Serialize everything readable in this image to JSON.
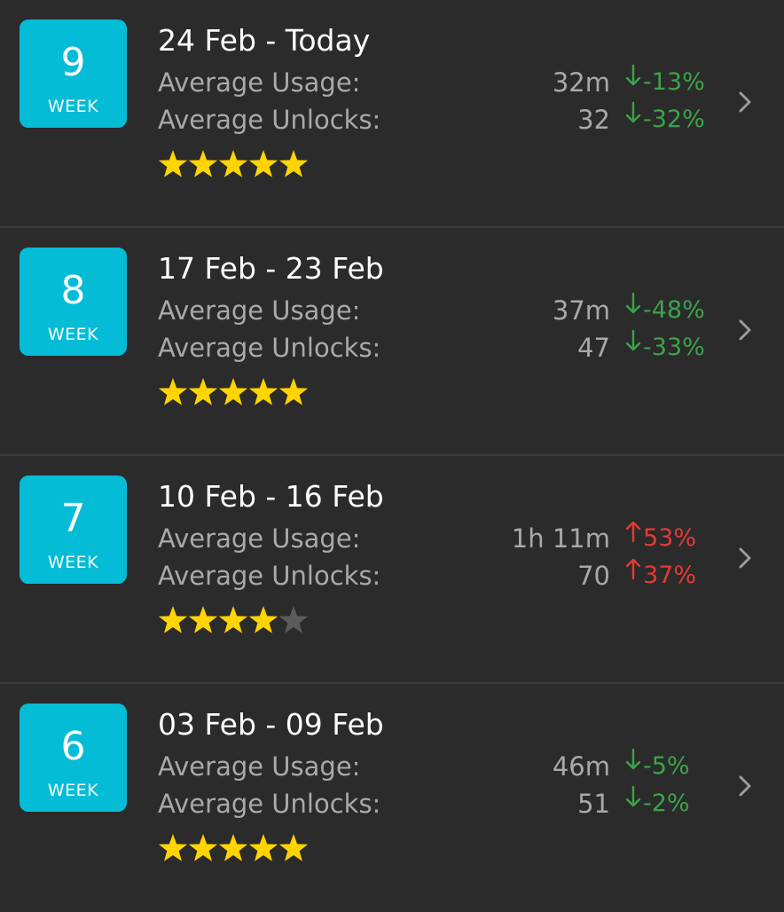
{
  "colors": {
    "background": "#2b2b2b",
    "badge": "#05bcd6",
    "star_on": "#ffd400",
    "star_off": "#5b5b5b",
    "down": "#3aa449",
    "up": "#e53a35",
    "muted_text": "#a9a9a9"
  },
  "weeks": [
    {
      "number": "9",
      "week_label": "WEEK",
      "range": "24 Feb - Today",
      "usage_label": "Average Usage:",
      "unlocks_label": "Average Unlocks:",
      "usage_value": "32m",
      "usage_direction": "down",
      "usage_change": "-13%",
      "unlocks_value": "32",
      "unlocks_direction": "down",
      "unlocks_change": "-32%",
      "rating": 5,
      "rating_max": 5
    },
    {
      "number": "8",
      "week_label": "WEEK",
      "range": "17 Feb - 23 Feb",
      "usage_label": "Average Usage:",
      "unlocks_label": "Average Unlocks:",
      "usage_value": "37m",
      "usage_direction": "down",
      "usage_change": "-48%",
      "unlocks_value": "47",
      "unlocks_direction": "down",
      "unlocks_change": "-33%",
      "rating": 5,
      "rating_max": 5
    },
    {
      "number": "7",
      "week_label": "WEEK",
      "range": "10 Feb - 16 Feb",
      "usage_label": "Average Usage:",
      "unlocks_label": "Average Unlocks:",
      "usage_value": "1h 11m",
      "usage_direction": "up",
      "usage_change": "53%",
      "unlocks_value": "70",
      "unlocks_direction": "up",
      "unlocks_change": "37%",
      "rating": 4,
      "rating_max": 5
    },
    {
      "number": "6",
      "week_label": "WEEK",
      "range": "03 Feb - 09 Feb",
      "usage_label": "Average Usage:",
      "unlocks_label": "Average Unlocks:",
      "usage_value": "46m",
      "usage_direction": "down",
      "usage_change": "-5%",
      "unlocks_value": "51",
      "unlocks_direction": "down",
      "unlocks_change": "-2%",
      "rating": 5,
      "rating_max": 5
    }
  ]
}
